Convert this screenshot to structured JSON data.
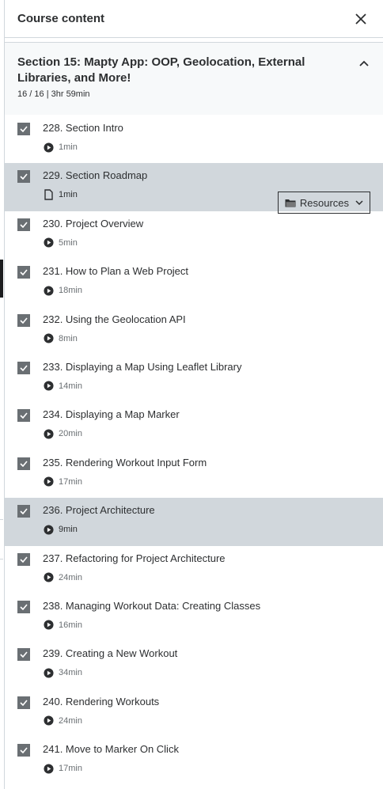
{
  "header": {
    "title": "Course content"
  },
  "section": {
    "title": "Section 15: Mapty App: OOP, Geolocation, External Libraries, and More!",
    "meta": "16 / 16 | 3hr 59min"
  },
  "lectures": [
    {
      "title": "228. Section Intro",
      "duration": "1min",
      "type": "video",
      "active": false
    },
    {
      "title": "229. Section Roadmap",
      "duration": "1min",
      "type": "file",
      "active": true,
      "resources_label": "Resources"
    },
    {
      "title": "230. Project Overview",
      "duration": "5min",
      "type": "video",
      "active": false
    },
    {
      "title": "231. How to Plan a Web Project",
      "duration": "18min",
      "type": "video",
      "active": false
    },
    {
      "title": "232. Using the Geolocation API",
      "duration": "8min",
      "type": "video",
      "active": false
    },
    {
      "title": "233. Displaying a Map Using Leaflet Library",
      "duration": "14min",
      "type": "video",
      "active": false
    },
    {
      "title": "234. Displaying a Map Marker",
      "duration": "20min",
      "type": "video",
      "active": false
    },
    {
      "title": "235. Rendering Workout Input Form",
      "duration": "17min",
      "type": "video",
      "active": false
    },
    {
      "title": "236. Project Architecture",
      "duration": "9min",
      "type": "video",
      "active": true
    },
    {
      "title": "237. Refactoring for Project Architecture",
      "duration": "24min",
      "type": "video",
      "active": false
    },
    {
      "title": "238. Managing Workout Data: Creating Classes",
      "duration": "16min",
      "type": "video",
      "active": false
    },
    {
      "title": "239. Creating a New Workout",
      "duration": "34min",
      "type": "video",
      "active": false
    },
    {
      "title": "240. Rendering Workouts",
      "duration": "24min",
      "type": "video",
      "active": false
    },
    {
      "title": "241. Move to Marker On Click",
      "duration": "17min",
      "type": "video",
      "active": false
    }
  ],
  "icons": {
    "close": "close-icon",
    "collapse": "chevron-up-icon",
    "checkbox": "check-icon",
    "video": "play-circle-icon",
    "file": "file-icon",
    "folder": "folder-icon",
    "dropdown": "chevron-down-icon"
  }
}
